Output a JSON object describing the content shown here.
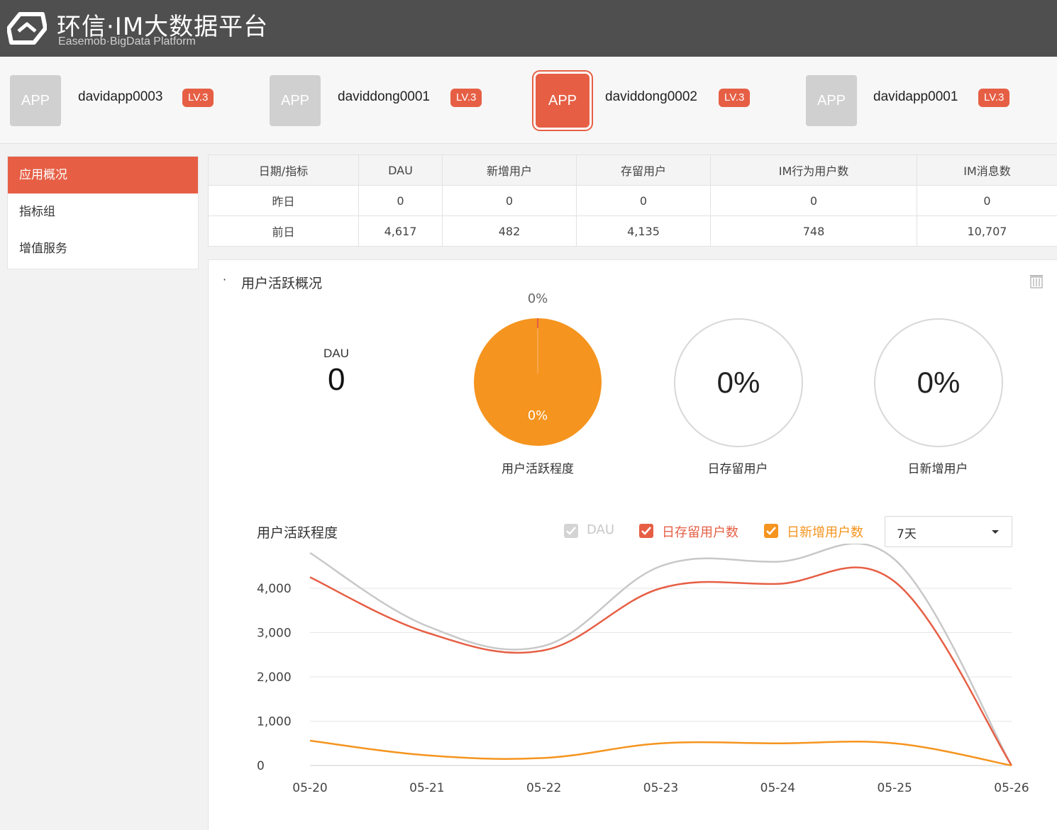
{
  "header": {
    "title": "环信·IM大数据平台",
    "subtitle": "Easemob·BigData Platform"
  },
  "apps": [
    {
      "icon": "APP",
      "name": "davidapp0003",
      "level": "LV.3",
      "active": false
    },
    {
      "icon": "APP",
      "name": "daviddong0001",
      "level": "LV.3",
      "active": false
    },
    {
      "icon": "APP",
      "name": "daviddong0002",
      "level": "LV.3",
      "active": true
    },
    {
      "icon": "APP",
      "name": "davidapp0001",
      "level": "LV.3",
      "active": false
    }
  ],
  "sidebar": {
    "items": [
      {
        "label": "应用概况",
        "active": true
      },
      {
        "label": "指标组",
        "active": false
      },
      {
        "label": "增值服务",
        "active": false
      }
    ]
  },
  "stats": {
    "headers": [
      "日期/指标",
      "DAU",
      "新增用户",
      "存留用户",
      "IM行为用户数",
      "IM消息数"
    ],
    "rows": [
      [
        "昨日",
        "0",
        "0",
        "0",
        "0",
        "0"
      ],
      [
        "前日",
        "4,617",
        "482",
        "4,135",
        "748",
        "10,707"
      ]
    ]
  },
  "overview": {
    "bullet": "·",
    "title": "用户活跃概况",
    "dau_label": "DAU",
    "dau_value": "0",
    "pie_top_label": "0%",
    "pie_inner_label": "0%",
    "pie_caption": "用户活跃程度",
    "retained_percent": "0%",
    "retained_caption": "日存留用户",
    "new_percent": "0%",
    "new_caption": "日新增用户"
  },
  "activity_chart": {
    "title": "用户活跃程度",
    "legend": [
      {
        "label": "DAU",
        "color": "#c8c8c8"
      },
      {
        "label": "日存留用户数",
        "color": "#e65f45"
      },
      {
        "label": "日新增用户数",
        "color": "#f5941e"
      }
    ],
    "range": "7天"
  },
  "colors": {
    "accent": "#e65f45",
    "orange": "#f5941e",
    "gray_line": "#c8c8c8",
    "header_bg": "#4f4f4f"
  },
  "chart_data": {
    "type": "line",
    "x": [
      "05-20",
      "05-21",
      "05-22",
      "05-23",
      "05-24",
      "05-25",
      "05-26"
    ],
    "series": [
      {
        "name": "DAU",
        "values": [
          4800,
          3150,
          2700,
          4500,
          4600,
          4650,
          0
        ]
      },
      {
        "name": "日存留用户数",
        "values": [
          4250,
          3000,
          2600,
          4000,
          4100,
          4150,
          0
        ]
      },
      {
        "name": "日新增用户数",
        "values": [
          560,
          230,
          170,
          500,
          500,
          500,
          0
        ]
      }
    ],
    "yticks": [
      "0",
      "1,000",
      "2,000",
      "3,000",
      "4,000"
    ],
    "ylim": [
      0,
      4800
    ],
    "grid": true
  }
}
